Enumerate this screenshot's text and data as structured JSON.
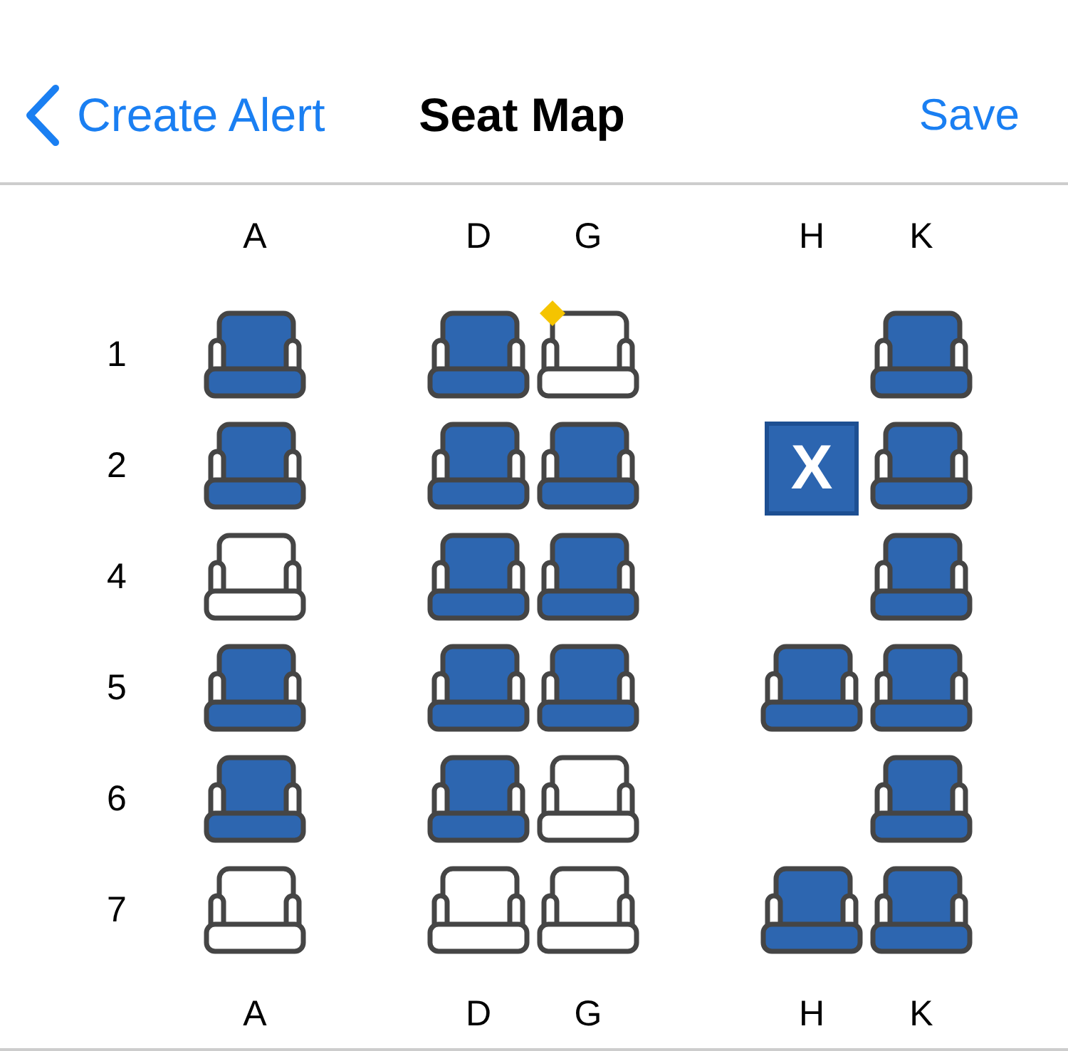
{
  "nav_bar": {
    "back_label": "Create Alert",
    "title": "Seat Map",
    "action": "Save"
  },
  "columns_top": [
    "A",
    "D",
    "G",
    "H",
    "K"
  ],
  "rows": [
    {
      "number": "1",
      "seats": [
        {
          "kind": "seat",
          "filled": true,
          "marked": false
        },
        {
          "kind": "seat",
          "filled": true,
          "marked": false
        },
        {
          "kind": "seat",
          "filled": false,
          "marked": true
        },
        {
          "kind": "none"
        },
        {
          "kind": "seat",
          "filled": true,
          "marked": false
        }
      ]
    },
    {
      "number": "2",
      "seats": [
        {
          "kind": "seat",
          "filled": true,
          "marked": false
        },
        {
          "kind": "seat",
          "filled": true,
          "marked": false
        },
        {
          "kind": "seat",
          "filled": true,
          "marked": false
        },
        {
          "kind": "blocked",
          "label": "X"
        },
        {
          "kind": "seat",
          "filled": true,
          "marked": false
        }
      ]
    },
    {
      "number": "4",
      "seats": [
        {
          "kind": "seat",
          "filled": false,
          "marked": false
        },
        {
          "kind": "seat",
          "filled": true,
          "marked": false
        },
        {
          "kind": "seat",
          "filled": true,
          "marked": false
        },
        {
          "kind": "none"
        },
        {
          "kind": "seat",
          "filled": true,
          "marked": false
        }
      ]
    },
    {
      "number": "5",
      "seats": [
        {
          "kind": "seat",
          "filled": true,
          "marked": false
        },
        {
          "kind": "seat",
          "filled": true,
          "marked": false
        },
        {
          "kind": "seat",
          "filled": true,
          "marked": false
        },
        {
          "kind": "seat",
          "filled": true,
          "marked": false
        },
        {
          "kind": "seat",
          "filled": true,
          "marked": false
        }
      ]
    },
    {
      "number": "6",
      "seats": [
        {
          "kind": "seat",
          "filled": true,
          "marked": false
        },
        {
          "kind": "seat",
          "filled": true,
          "marked": false
        },
        {
          "kind": "seat",
          "filled": false,
          "marked": false
        },
        {
          "kind": "none"
        },
        {
          "kind": "seat",
          "filled": true,
          "marked": false
        }
      ]
    },
    {
      "number": "7",
      "seats": [
        {
          "kind": "seat",
          "filled": false,
          "marked": false
        },
        {
          "kind": "seat",
          "filled": false,
          "marked": false
        },
        {
          "kind": "seat",
          "filled": false,
          "marked": false
        },
        {
          "kind": "seat",
          "filled": true,
          "marked": false
        },
        {
          "kind": "seat",
          "filled": true,
          "marked": false
        }
      ]
    }
  ],
  "columns_bottom": [
    "A",
    "D",
    "G",
    "H",
    "K"
  ]
}
